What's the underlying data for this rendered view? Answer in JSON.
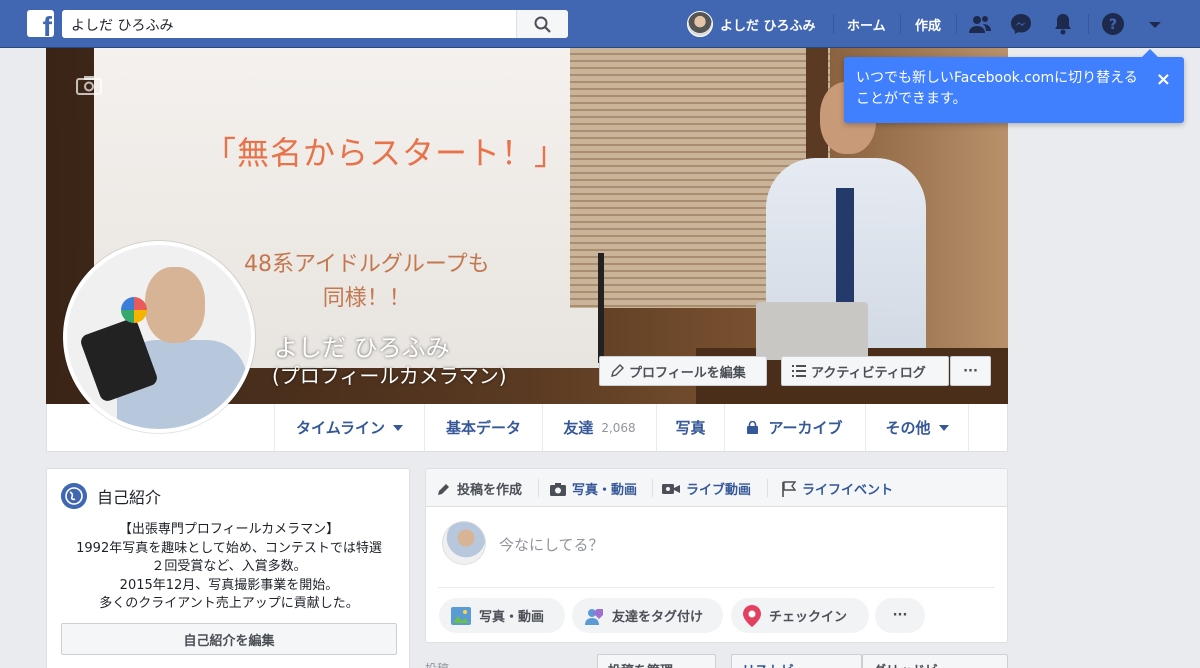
{
  "topbar": {
    "search_value": "よしだ ひろふみ",
    "user_name": "よしだ ひろふみ",
    "home": "ホーム",
    "create": "作成"
  },
  "tooltip": {
    "text": "いつでも新しいFacebook.comに切り替えることができます。",
    "close": "×"
  },
  "cover": {
    "screen_title": "「無名からスタート！」",
    "screen_sub_1": "48系アイドルグループも",
    "screen_sub_2": "同様！！",
    "name": "よしだ ひろふみ",
    "alternate_name": "(プロフィールカメラマン)",
    "edit_profile": "プロフィールを編集",
    "activity_log": "アクティビティログ",
    "more": "···"
  },
  "tabs": [
    {
      "label": "タイムライン"
    },
    {
      "label": "基本データ"
    },
    {
      "label": "友達",
      "count": "2,068"
    },
    {
      "label": "写真"
    },
    {
      "label": "アーカイブ"
    },
    {
      "label": "その他"
    }
  ],
  "intro": {
    "title": "自己紹介",
    "lines": [
      "【出張専門プロフィールカメラマン】",
      "1992年写真を趣味として始め、コンテストでは特選",
      "２回受賞など、入賞多数。",
      "2015年12月、写真撮影事業を開始。",
      "多くのクライアント売上アップに貢献した。"
    ],
    "edit_button": "自己紹介を編集"
  },
  "composer": {
    "create_post": "投稿を作成",
    "photo_video": "写真・動画",
    "live_video": "ライブ動画",
    "life_event": "ライフイベント",
    "placeholder": "今なにしてる？",
    "pill_photo": "写真・動画",
    "pill_tag": "友達をタグ付け",
    "pill_checkin": "チェックイン",
    "pill_more": "···"
  },
  "bottom": {
    "label": "投稿",
    "manage_posts": "投稿を管理",
    "list_view": "リストビュー",
    "grid_view": "グリッドビュー"
  },
  "colors": {
    "brand": "#4267b2",
    "link": "#365899",
    "tooltip": "#4080ff"
  }
}
